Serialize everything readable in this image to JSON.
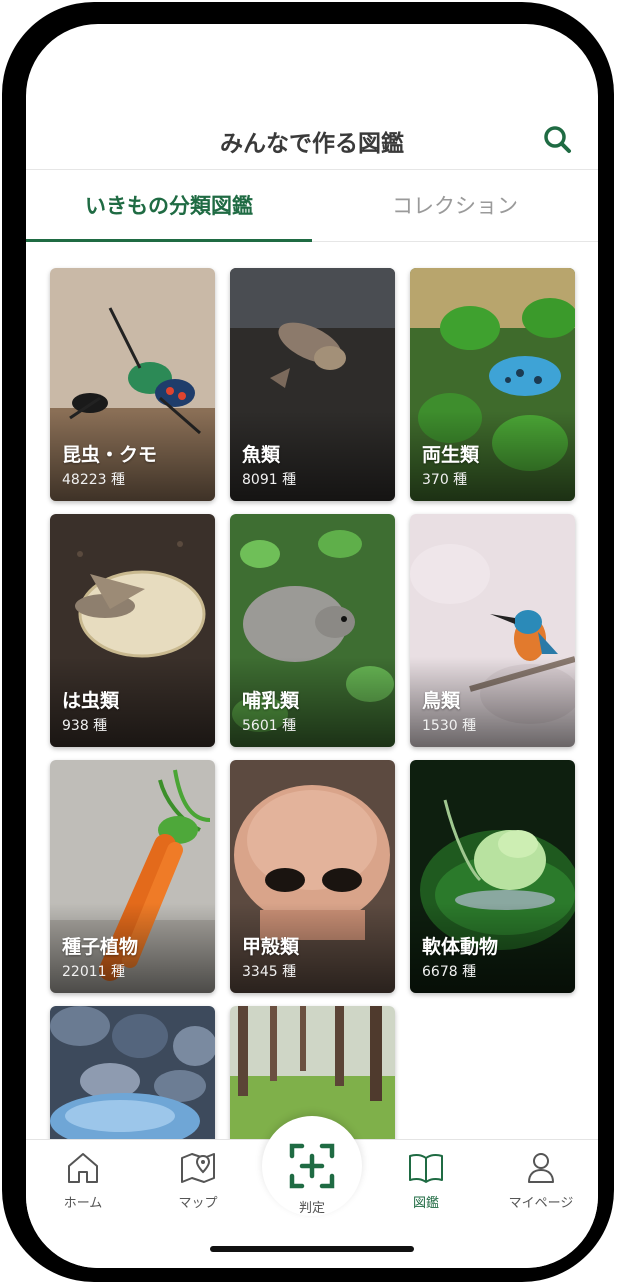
{
  "header": {
    "title": "みんなで作る図鑑",
    "search_icon": "search-icon",
    "accent": "#1f6b43"
  },
  "tabs": [
    {
      "label": "いきもの分類図鑑",
      "active": true
    },
    {
      "label": "コレクション",
      "active": false
    }
  ],
  "categories": [
    {
      "name": "昆虫・クモ",
      "count": "48223 種"
    },
    {
      "name": "魚類",
      "count": "8091 種"
    },
    {
      "name": "両生類",
      "count": "370 種"
    },
    {
      "name": "は虫類",
      "count": "938 種"
    },
    {
      "name": "哺乳類",
      "count": "5601 種"
    },
    {
      "name": "鳥類",
      "count": "1530 種"
    },
    {
      "name": "種子植物",
      "count": "22011 種"
    },
    {
      "name": "甲殻類",
      "count": "3345 種"
    },
    {
      "name": "軟体動物",
      "count": "6678 種"
    }
  ],
  "tabbar": {
    "items": [
      {
        "label": "ホーム",
        "icon": "home-icon"
      },
      {
        "label": "マップ",
        "icon": "map-icon"
      },
      {
        "label": "判定",
        "icon": "scan-plus-icon"
      },
      {
        "label": "図鑑",
        "icon": "book-icon",
        "active": true
      },
      {
        "label": "マイページ",
        "icon": "user-icon"
      }
    ]
  }
}
